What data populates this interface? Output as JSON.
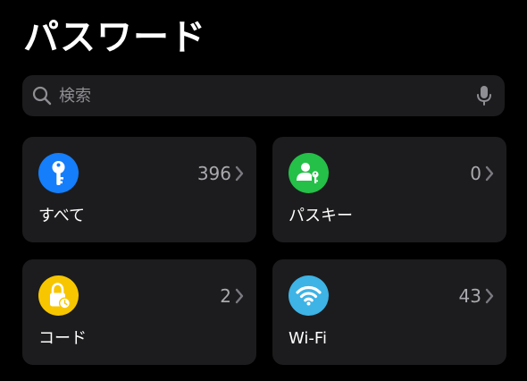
{
  "header": {
    "title": "パスワード"
  },
  "search": {
    "placeholder": "検索"
  },
  "tiles": [
    {
      "label": "すべて",
      "count": "396",
      "icon": "key-icon",
      "color": "#147efb"
    },
    {
      "label": "パスキー",
      "count": "0",
      "icon": "person-key-icon",
      "color": "#24c048"
    },
    {
      "label": "コード",
      "count": "2",
      "icon": "lock-clock-icon",
      "color": "#f7c600"
    },
    {
      "label": "Wi-Fi",
      "count": "43",
      "icon": "wifi-icon",
      "color": "#3eb3e5"
    }
  ],
  "colors": {
    "background": "#000000",
    "tile_background": "#1c1c1e",
    "secondary_text": "#8e8e93"
  }
}
